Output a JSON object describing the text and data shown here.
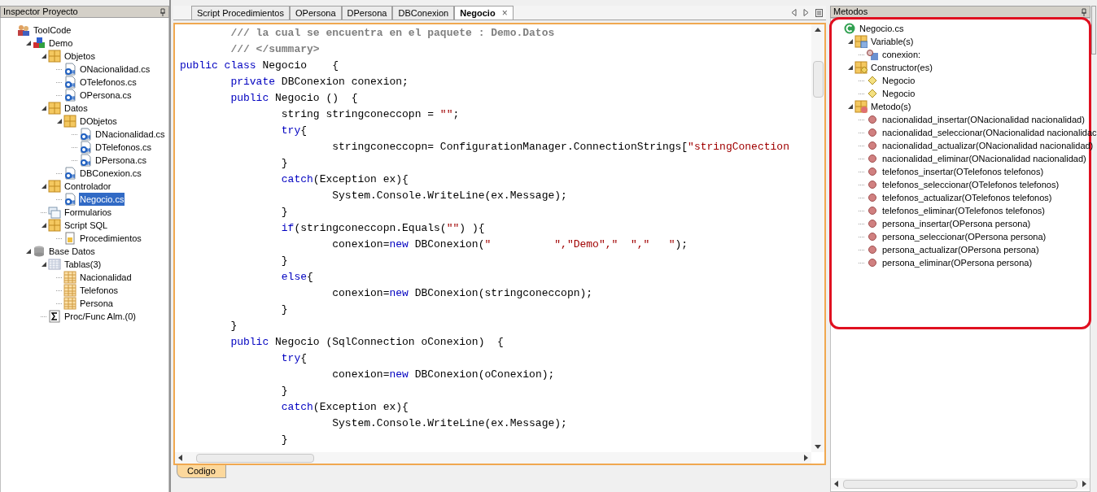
{
  "project_panel": {
    "title": "Inspector Proyecto",
    "tree": [
      {
        "label": "ToolCode",
        "kind": "users",
        "selected": false,
        "children": [
          {
            "label": "Demo",
            "kind": "project",
            "selected": false,
            "expanded": true,
            "children": [
              {
                "label": "Objetos",
                "kind": "folder",
                "selected": false,
                "expanded": true,
                "children": [
                  {
                    "label": "ONacionalidad.cs",
                    "kind": "csharp",
                    "selected": false
                  },
                  {
                    "label": "OTelefonos.cs",
                    "kind": "csharp",
                    "selected": false
                  },
                  {
                    "label": "OPersona.cs",
                    "kind": "csharp",
                    "selected": false
                  }
                ]
              },
              {
                "label": "Datos",
                "kind": "folder",
                "selected": false,
                "expanded": true,
                "children": [
                  {
                    "label": "DObjetos",
                    "kind": "folder",
                    "selected": false,
                    "expanded": true,
                    "children": [
                      {
                        "label": "DNacionalidad.cs",
                        "kind": "csharp",
                        "selected": false
                      },
                      {
                        "label": "DTelefonos.cs",
                        "kind": "csharp",
                        "selected": false
                      },
                      {
                        "label": "DPersona.cs",
                        "kind": "csharp",
                        "selected": false
                      }
                    ]
                  },
                  {
                    "label": "DBConexion.cs",
                    "kind": "csharp",
                    "selected": false
                  }
                ]
              },
              {
                "label": "Controlador",
                "kind": "folder",
                "selected": false,
                "expanded": true,
                "children": [
                  {
                    "label": "Negocio.cs",
                    "kind": "csharp",
                    "selected": true
                  }
                ]
              },
              {
                "label": "Formularios",
                "kind": "forms",
                "selected": false
              },
              {
                "label": "Script SQL",
                "kind": "folder",
                "selected": false,
                "expanded": true,
                "children": [
                  {
                    "label": "Procedimientos",
                    "kind": "script",
                    "selected": false
                  }
                ]
              }
            ]
          },
          {
            "label": "Base Datos",
            "kind": "database",
            "selected": false,
            "expanded": true,
            "children": [
              {
                "label": "Tablas(3)",
                "kind": "grid",
                "selected": false,
                "expanded": true,
                "children": [
                  {
                    "label": "Nacionalidad",
                    "kind": "table",
                    "selected": false
                  },
                  {
                    "label": "Telefonos",
                    "kind": "table",
                    "selected": false
                  },
                  {
                    "label": "Persona",
                    "kind": "table",
                    "selected": false
                  }
                ]
              },
              {
                "label": "Proc/Func Alm.(0)",
                "kind": "sigma",
                "selected": false
              }
            ]
          }
        ]
      }
    ]
  },
  "editor": {
    "tabs": [
      {
        "label": "Script Procedimientos",
        "selected": false
      },
      {
        "label": "OPersona",
        "selected": false
      },
      {
        "label": "DPersona",
        "selected": false
      },
      {
        "label": "DBConexion",
        "selected": false
      },
      {
        "label": "Negocio",
        "selected": true,
        "close": "×"
      }
    ],
    "lines": [
      [
        {
          "kind": "comment",
          "text": "        /// la cual se encuentra en el paquete : Demo.Datos"
        }
      ],
      [
        {
          "kind": "comment",
          "text": "        /// </summary>"
        }
      ],
      [
        {
          "kind": "keyword",
          "text": "public class"
        },
        {
          "kind": "plain",
          "text": " Negocio    {"
        }
      ],
      [
        {
          "kind": "keyword",
          "text": "        private"
        },
        {
          "kind": "plain",
          "text": " DBConexion conexion;"
        }
      ],
      [
        {
          "kind": "keyword",
          "text": "        public"
        },
        {
          "kind": "plain",
          "text": " Negocio ()  {"
        }
      ],
      [
        {
          "kind": "plain",
          "text": "                string stringconeccopn = "
        },
        {
          "kind": "string",
          "text": "\"\""
        },
        {
          "kind": "plain",
          "text": ";"
        }
      ],
      [
        {
          "kind": "keyword",
          "text": "                try"
        },
        {
          "kind": "plain",
          "text": "{"
        }
      ],
      [
        {
          "kind": "plain",
          "text": "                        stringconeccopn= ConfigurationManager.ConnectionStrings["
        },
        {
          "kind": "string",
          "text": "\"stringConection"
        }
      ],
      [
        {
          "kind": "plain",
          "text": "                }"
        }
      ],
      [
        {
          "kind": "keyword",
          "text": "                catch"
        },
        {
          "kind": "plain",
          "text": "(Exception ex){"
        }
      ],
      [
        {
          "kind": "plain",
          "text": "                        System.Console.WriteLine(ex.Message);"
        }
      ],
      [
        {
          "kind": "plain",
          "text": "                }"
        }
      ],
      [
        {
          "kind": "keyword",
          "text": "                if"
        },
        {
          "kind": "plain",
          "text": "(stringconeccopn.Equals("
        },
        {
          "kind": "string",
          "text": "\"\""
        },
        {
          "kind": "plain",
          "text": ") ){"
        }
      ],
      [
        {
          "kind": "plain",
          "text": "                        conexion="
        },
        {
          "kind": "keyword",
          "text": "new"
        },
        {
          "kind": "plain",
          "text": " DBConexion("
        },
        {
          "kind": "string",
          "text": "\"          \",\"Demo\",\"  \",\"   \""
        },
        {
          "kind": "plain",
          "text": ");"
        }
      ],
      [
        {
          "kind": "plain",
          "text": "                }"
        }
      ],
      [
        {
          "kind": "keyword",
          "text": "                else"
        },
        {
          "kind": "plain",
          "text": "{"
        }
      ],
      [
        {
          "kind": "plain",
          "text": "                        conexion="
        },
        {
          "kind": "keyword",
          "text": "new"
        },
        {
          "kind": "plain",
          "text": " DBConexion(stringconeccopn);"
        }
      ],
      [
        {
          "kind": "plain",
          "text": "                }"
        }
      ],
      [
        {
          "kind": "plain",
          "text": "        }"
        }
      ],
      [
        {
          "kind": "keyword",
          "text": "        public"
        },
        {
          "kind": "plain",
          "text": " Negocio (SqlConnection oConexion)  {"
        }
      ],
      [
        {
          "kind": "keyword",
          "text": "                try"
        },
        {
          "kind": "plain",
          "text": "{"
        }
      ],
      [
        {
          "kind": "plain",
          "text": "                        conexion="
        },
        {
          "kind": "keyword",
          "text": "new"
        },
        {
          "kind": "plain",
          "text": " DBConexion(oConexion);"
        }
      ],
      [
        {
          "kind": "plain",
          "text": "                }"
        }
      ],
      [
        {
          "kind": "keyword",
          "text": "                catch"
        },
        {
          "kind": "plain",
          "text": "(Exception ex){"
        }
      ],
      [
        {
          "kind": "plain",
          "text": "                        System.Console.WriteLine(ex.Message);"
        }
      ],
      [
        {
          "kind": "plain",
          "text": "                }"
        }
      ]
    ],
    "bottom_tabs": [
      {
        "label": "Codigo",
        "selected": true
      }
    ]
  },
  "methods_panel": {
    "title": "Metodos",
    "highlighted": true,
    "tree": [
      {
        "label": "Negocio.cs",
        "kind": "class",
        "selected": false,
        "children": [
          {
            "label": "Variable(s)",
            "kind": "variables",
            "selected": false,
            "expanded": true,
            "children": [
              {
                "label": "conexion:",
                "kind": "field",
                "selected": false
              }
            ]
          },
          {
            "label": "Constructor(es)",
            "kind": "constructors",
            "selected": false,
            "expanded": true,
            "children": [
              {
                "label": "Negocio",
                "kind": "constructor",
                "selected": false
              },
              {
                "label": "Negocio",
                "kind": "constructor",
                "selected": false
              }
            ]
          },
          {
            "label": "Metodo(s)",
            "kind": "methods",
            "selected": false,
            "expanded": true,
            "children": [
              {
                "label": "nacionalidad_insertar(ONacionalidad nacionalidad)",
                "kind": "method",
                "selected": false
              },
              {
                "label": "nacionalidad_seleccionar(ONacionalidad nacionalidac",
                "kind": "method",
                "selected": false
              },
              {
                "label": "nacionalidad_actualizar(ONacionalidad nacionalidad)",
                "kind": "method",
                "selected": false
              },
              {
                "label": "nacionalidad_eliminar(ONacionalidad nacionalidad)",
                "kind": "method",
                "selected": false
              },
              {
                "label": "telefonos_insertar(OTelefonos telefonos)",
                "kind": "method",
                "selected": false
              },
              {
                "label": "telefonos_seleccionar(OTelefonos telefonos)",
                "kind": "method",
                "selected": false
              },
              {
                "label": "telefonos_actualizar(OTelefonos telefonos)",
                "kind": "method",
                "selected": false
              },
              {
                "label": "telefonos_eliminar(OTelefonos telefonos)",
                "kind": "method",
                "selected": false
              },
              {
                "label": "persona_insertar(OPersona persona)",
                "kind": "method",
                "selected": false
              },
              {
                "label": "persona_seleccionar(OPersona persona)",
                "kind": "method",
                "selected": false
              },
              {
                "label": "persona_actualizar(OPersona persona)",
                "kind": "method",
                "selected": false
              },
              {
                "label": "persona_eliminar(OPersona persona)",
                "kind": "method",
                "selected": false
              }
            ]
          }
        ]
      }
    ]
  }
}
